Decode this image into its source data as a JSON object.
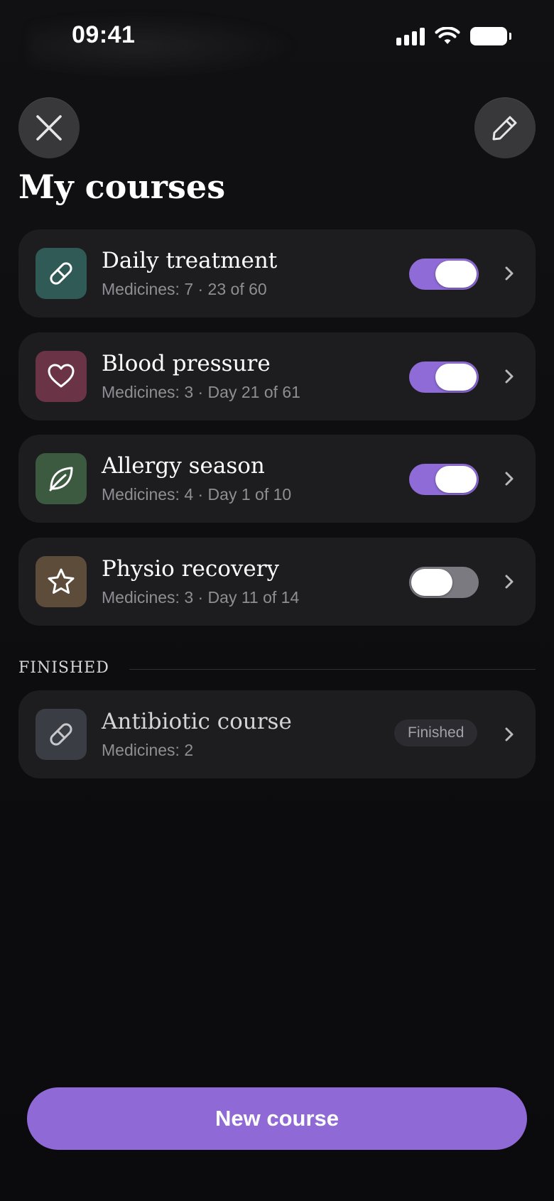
{
  "status_bar": {
    "time": "09:41"
  },
  "header": {
    "close_icon": "close-icon",
    "edit_icon": "pencil-icon",
    "title": "My courses"
  },
  "courses": [
    {
      "title": "Daily treatment",
      "subtitle": "Medicines: 7 · 23 of 60",
      "icon": "pill-icon",
      "icon_bg": "#2f5a55",
      "enabled": true
    },
    {
      "title": "Blood pressure",
      "subtitle": "Medicines: 3 · Day 21 of 61",
      "icon": "heart-icon",
      "icon_bg": "#6b3346",
      "enabled": true
    },
    {
      "title": "Allergy season",
      "subtitle": "Medicines: 4 · Day 1 of 10",
      "icon": "leaf-icon",
      "icon_bg": "#3b5a40",
      "enabled": true
    },
    {
      "title": "Physio recovery",
      "subtitle": "Medicines: 3 · Day 11 of 14",
      "icon": "star-icon",
      "icon_bg": "#5c4c39",
      "enabled": false
    }
  ],
  "finished_section": {
    "label": "FINISHED",
    "items": [
      {
        "title": "Antibiotic course",
        "subtitle": "Medicines: 2",
        "icon": "pill-icon",
        "icon_bg": "#3a3d44",
        "badge": "Finished"
      }
    ]
  },
  "footer": {
    "new_course_label": "New course"
  },
  "colors": {
    "accent": "#8f6ad6",
    "card_bg": "#1d1d20",
    "background": "#0b0b0d"
  }
}
